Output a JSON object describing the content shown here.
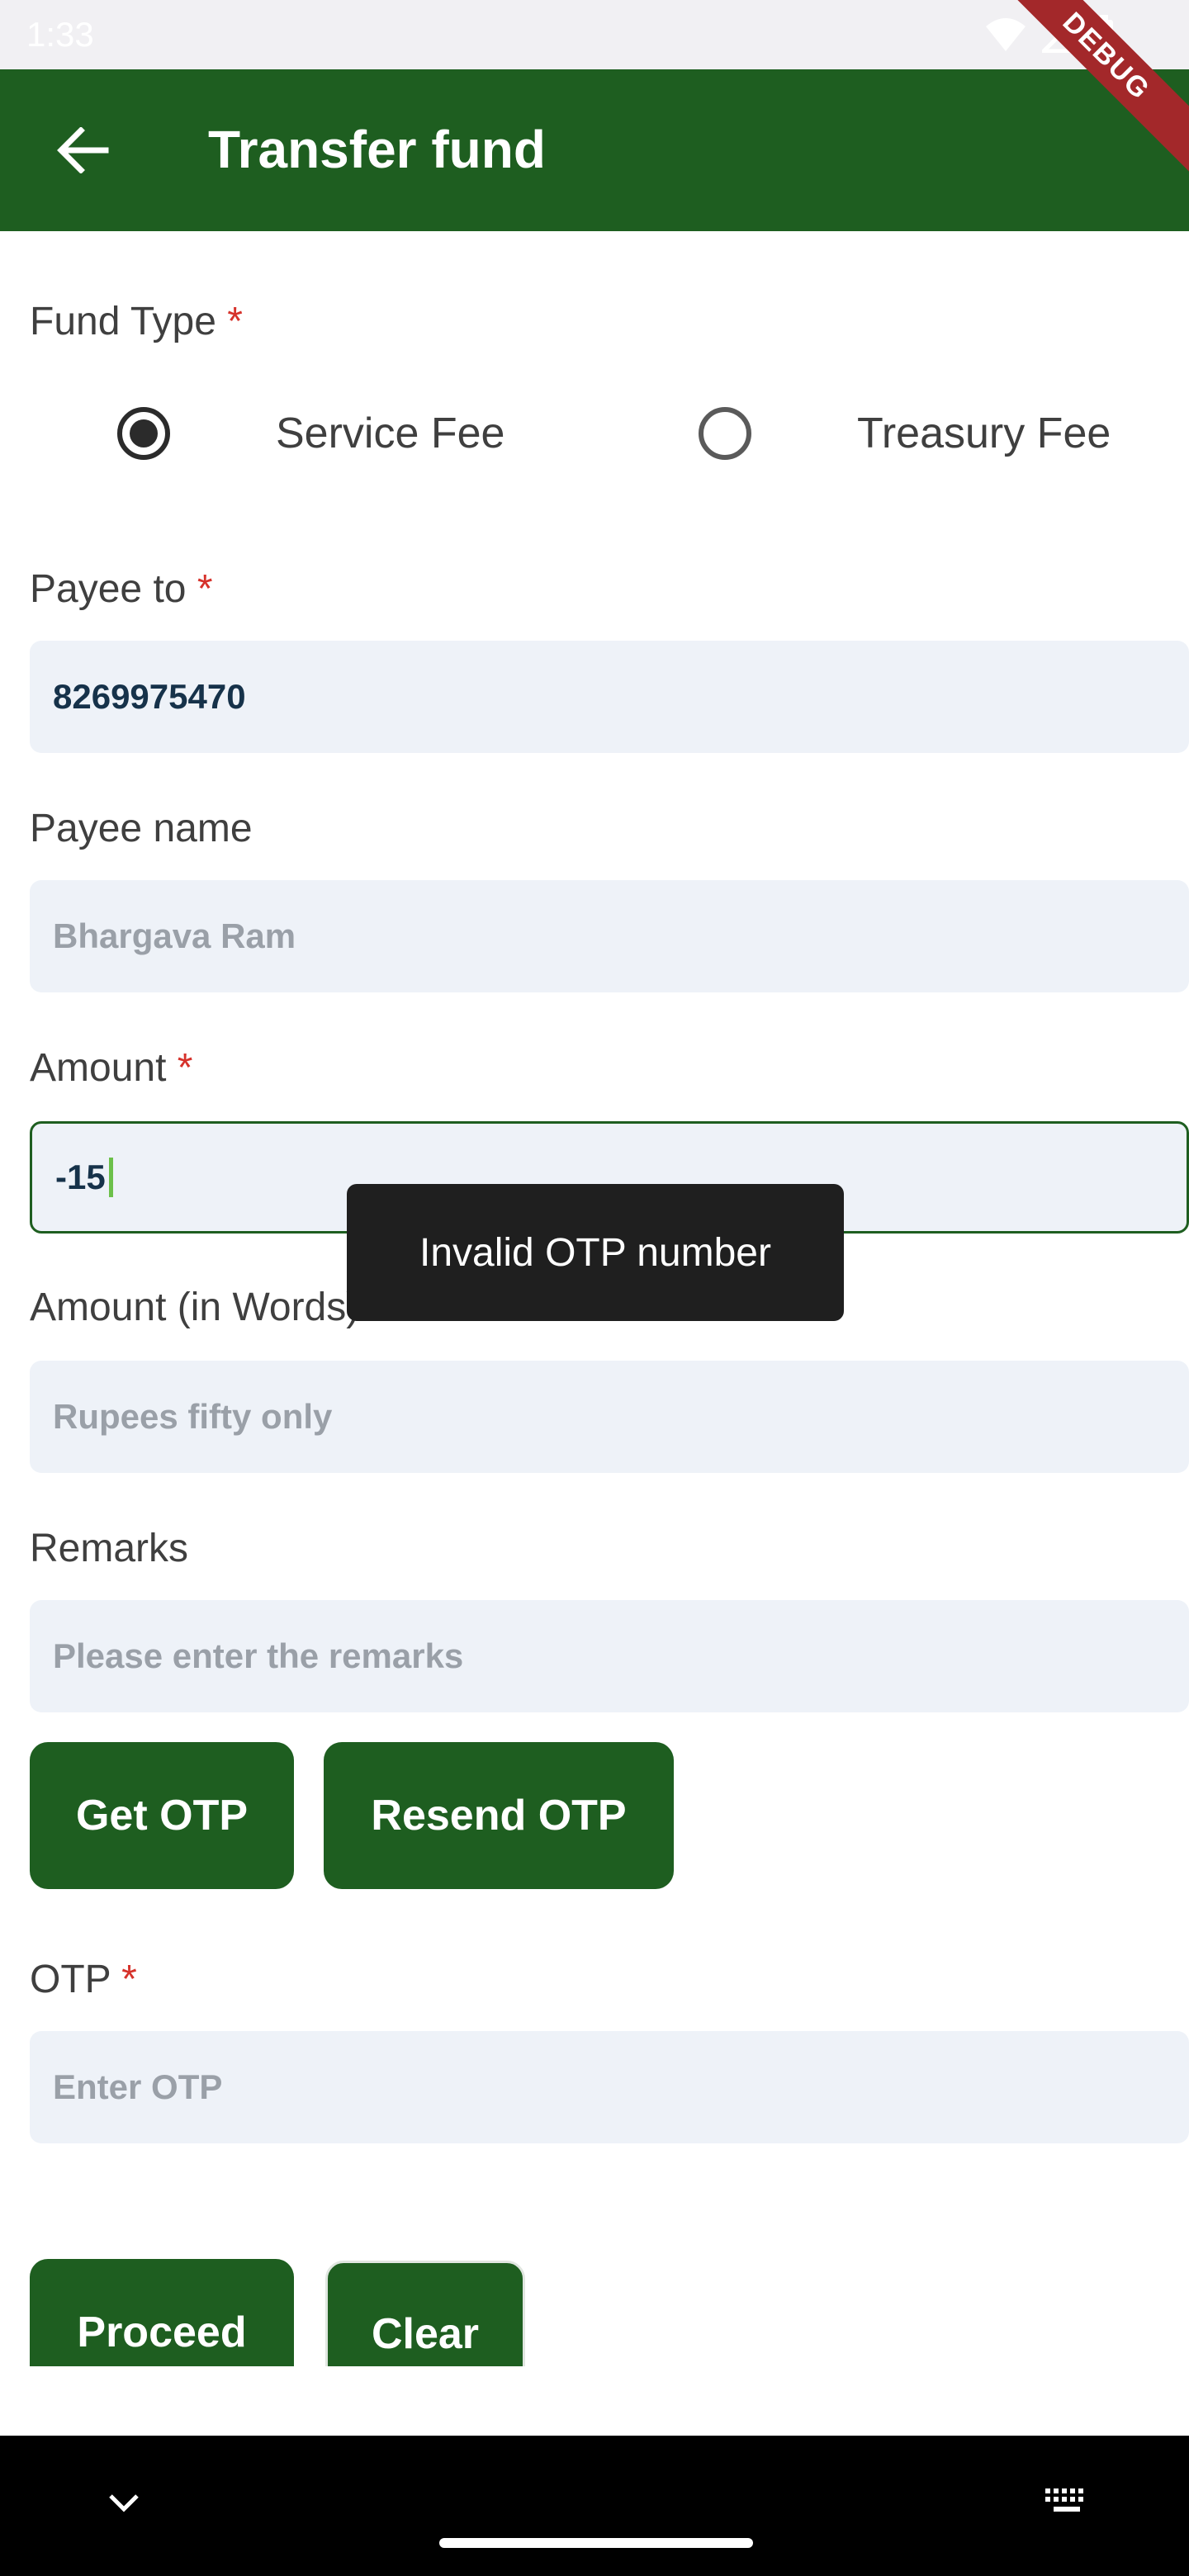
{
  "status_bar": {
    "time": "1:33"
  },
  "debug_label": "DEBUG",
  "app_bar": {
    "title": "Transfer fund"
  },
  "fund_type": {
    "label": "Fund Type",
    "required_mark": "*",
    "options": [
      {
        "label": "Service Fee",
        "selected": true
      },
      {
        "label": "Treasury Fee",
        "selected": false
      }
    ]
  },
  "payee_to": {
    "label": "Payee to",
    "required_mark": "*",
    "value": "8269975470"
  },
  "payee_name": {
    "label": "Payee name",
    "placeholder": "Bhargava Ram"
  },
  "amount": {
    "label": "Amount",
    "required_mark": "*",
    "value": "-15"
  },
  "amount_words": {
    "label": "Amount (in Words)",
    "placeholder": "Rupees fifty only"
  },
  "remarks": {
    "label": "Remarks",
    "placeholder": "Please enter the remarks"
  },
  "otp_buttons": {
    "get": "Get OTP",
    "resend": "Resend OTP"
  },
  "otp": {
    "label": "OTP",
    "required_mark": "*",
    "placeholder": "Enter OTP"
  },
  "actions": {
    "proceed": "Proceed",
    "clear": "Clear"
  },
  "toast": {
    "message": "Invalid OTP number"
  },
  "colors": {
    "primary": "#1e5e20",
    "required": "#d6322b",
    "field_bg": "#eef2f8",
    "toast_bg": "#1f1f1f"
  },
  "icons": {
    "back": "arrow-left-icon",
    "nav_back": "chevron-down-icon",
    "keyboard": "keyboard-icon"
  }
}
